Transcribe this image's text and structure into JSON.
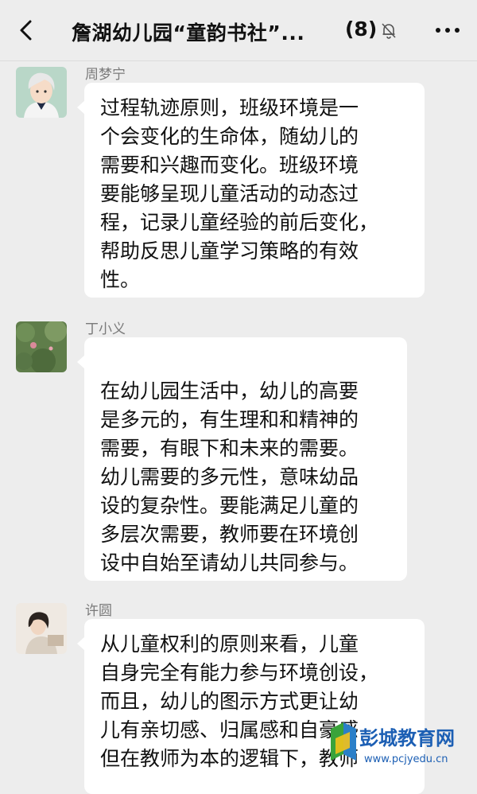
{
  "header": {
    "title": "詹湖幼儿园“童韵书社”...",
    "member_count": "(8)",
    "back_icon": "chevron-left-icon",
    "mute_icon": "bell-muted-icon",
    "more_icon": "more-horizontal-icon"
  },
  "messages": [
    {
      "sender": "周梦宁",
      "lines": [
        "过程轨迹原则，班级环境是一",
        "个会变化的生命体，随幼儿的",
        "需要和兴趣而变化。班级环境",
        "要能够呈现儿童活动的动态过",
        "程，记录儿童经验的前后变化，",
        "帮助反思儿童学习策略的有效",
        "性。"
      ]
    },
    {
      "sender": "丁小义",
      "lines": [
        "在幼儿园生活中，幼儿的高要",
        "是多元的，有生理和和精神的",
        "需要，有眼下和未来的需要。",
        "幼儿需要的多元性，意味幼品",
        "设的复杂性。要能满足儿童的",
        "多层次需要，教师要在环境创",
        "设中自始至请幼儿共同参与。"
      ]
    },
    {
      "sender": "许圆",
      "lines": [
        "从儿童权利的原则来看，儿童",
        "自身完全有能力参与环境创设，",
        "而且，幼儿的图示方式更让幼",
        "儿有亲切感、归属感和自豪感",
        "但在教师为本的逻辑下，教师"
      ]
    }
  ],
  "watermark": {
    "name": "彭城教育网",
    "url": "www.pcjyedu.cn"
  },
  "colors": {
    "background": "#ededed",
    "bubble": "#ffffff",
    "sender": "#7a7a7a",
    "watermark_blue": "#1c5fb4",
    "watermark_green": "#3aa33a"
  }
}
